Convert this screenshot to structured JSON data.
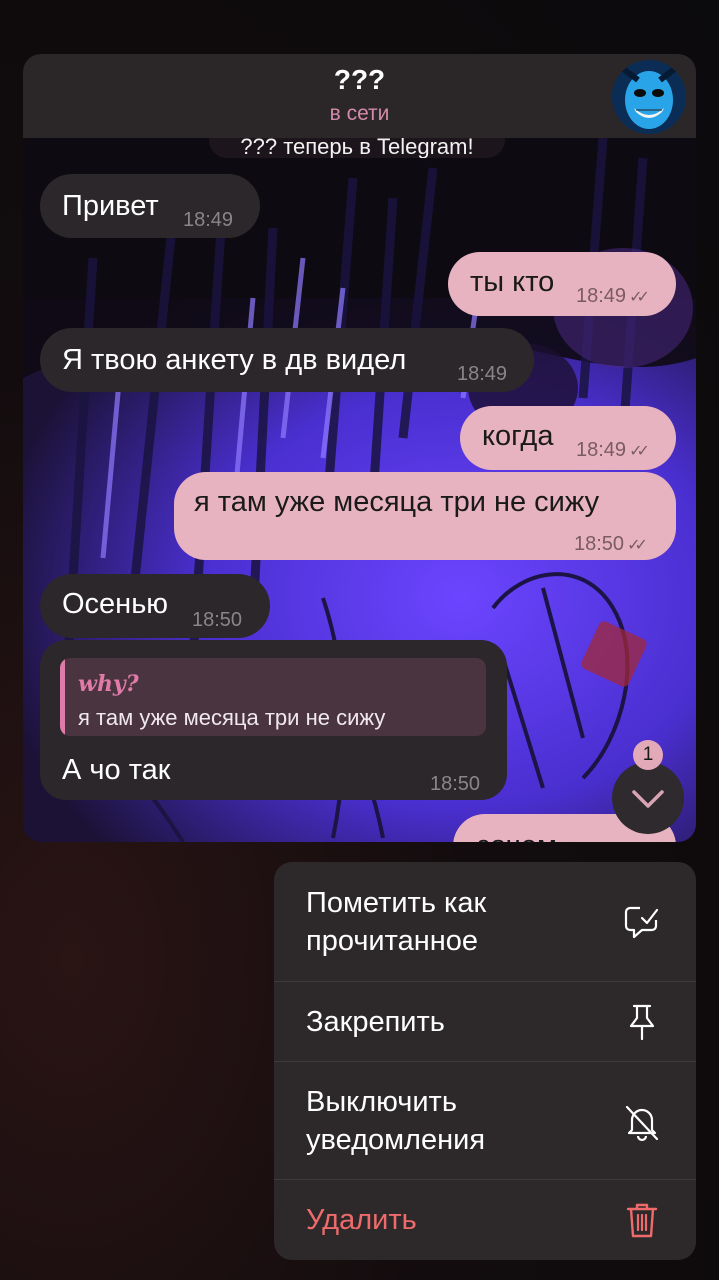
{
  "header": {
    "title": "???",
    "status": "в сети"
  },
  "service_message": "??? теперь в Telegram!",
  "messages": [
    {
      "direction": "in",
      "text": "Привет",
      "time": "18:49"
    },
    {
      "direction": "out",
      "text": "ты кто",
      "time": "18:49",
      "read": true
    },
    {
      "direction": "in",
      "text": "Я твою анкету в дв видел",
      "time": "18:49"
    },
    {
      "direction": "out",
      "text": "когда",
      "time": "18:49",
      "read": true
    },
    {
      "direction": "out",
      "text": "я там уже месяца три не сижу",
      "time": "18:50",
      "read": true
    },
    {
      "direction": "in",
      "text": "Осенью",
      "time": "18:50"
    },
    {
      "direction": "in",
      "reply_to": {
        "name": "why?",
        "text": "я там уже месяца три не сижу"
      },
      "text": "А чо так",
      "time": "18:50"
    },
    {
      "direction": "out",
      "text": "зачем",
      "time": ""
    }
  ],
  "scroll_button": {
    "unread_count": "1",
    "icon": "chevron-down-icon"
  },
  "context_menu": {
    "items": [
      {
        "label": "Пометить как\nпрочитанное",
        "icon": "mark-read-icon"
      },
      {
        "label": "Закрепить",
        "icon": "pin-icon"
      },
      {
        "label": "Выключить\nуведомления",
        "icon": "bell-off-icon"
      },
      {
        "label": "Удалить",
        "icon": "trash-icon",
        "destructive": true
      }
    ]
  },
  "colors": {
    "incoming_bubble": "#2b272a",
    "outgoing_bubble": "#e8b3c1",
    "accent_pink": "#d28aa8",
    "destructive": "#ef6b6b",
    "menu_background": "#2d292b"
  }
}
